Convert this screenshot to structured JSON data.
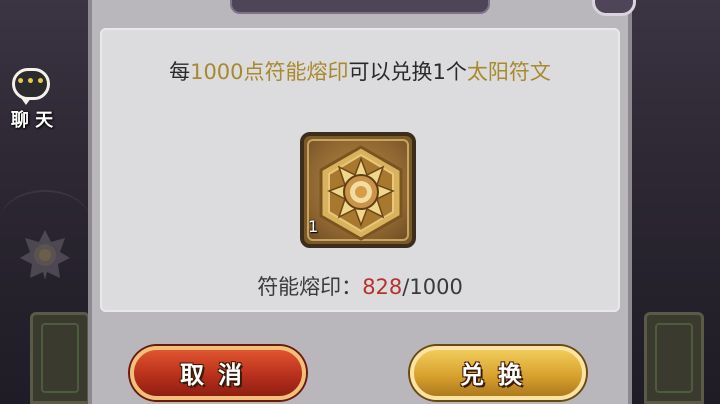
{
  "sidebar": {
    "chat_label": "聊 天",
    "chat_dots": "•••"
  },
  "dialog": {
    "message": {
      "prefix": "每",
      "amount": "1000点符能熔印",
      "middle": "可以兑换1个",
      "reward": "太阳符文"
    },
    "item": {
      "icon": "sun-rune-icon",
      "count": "1"
    },
    "progress": {
      "label": "符能熔印：",
      "current": "828",
      "separator": "/",
      "required": "1000"
    },
    "buttons": {
      "cancel_label": "取消",
      "confirm_label": "兑换"
    }
  },
  "colors": {
    "highlight": "#a88a2c",
    "current_value": "#b8312b",
    "cancel_button": "#b9301c",
    "confirm_button": "#d8a22f",
    "panel": "#dcdbde"
  }
}
